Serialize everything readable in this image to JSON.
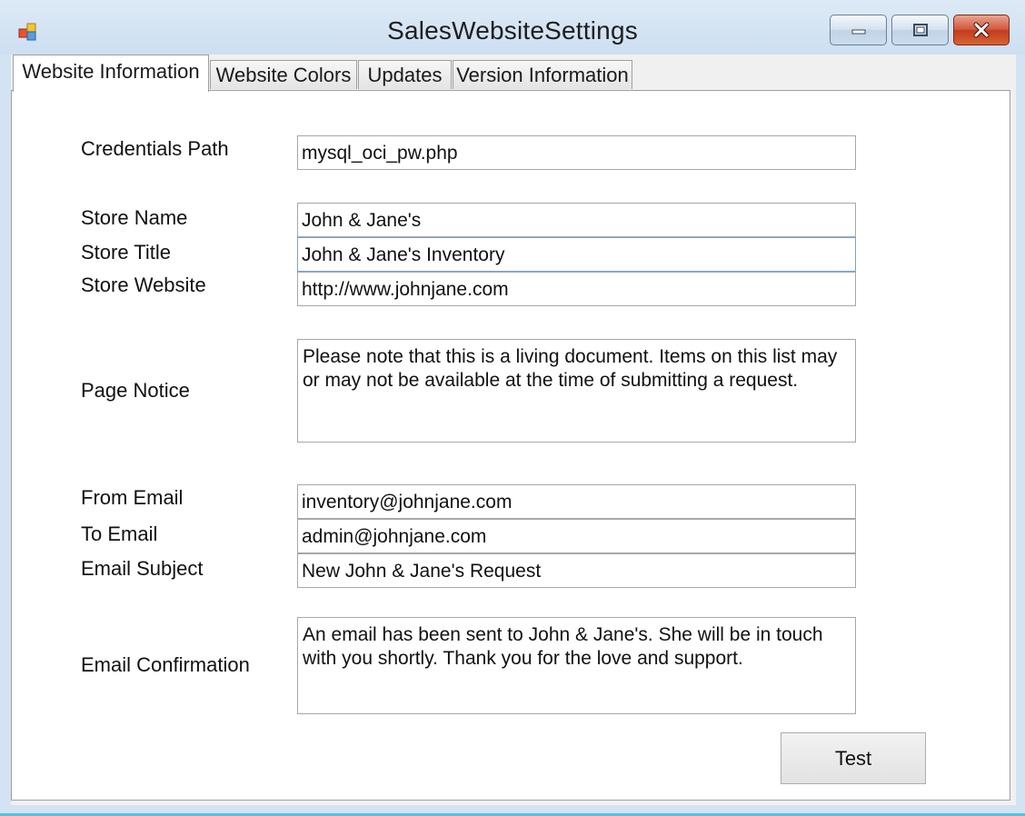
{
  "window": {
    "title": "SalesWebsiteSettings",
    "app_icon": "windows-forms-icon",
    "caption_buttons": [
      "minimize-icon",
      "maximize-icon",
      "close-icon"
    ]
  },
  "tabs": [
    {
      "label": "Website Information",
      "active": true
    },
    {
      "label": "Website Colors",
      "active": false
    },
    {
      "label": "Updates",
      "active": false
    },
    {
      "label": "Version Information",
      "active": false
    }
  ],
  "form": {
    "credentials_path": {
      "label": "Credentials Path",
      "value": "mysql_oci_pw.php"
    },
    "store_name": {
      "label": "Store Name",
      "value": "John & Jane's"
    },
    "store_title": {
      "label": "Store Title",
      "value": "John & Jane's Inventory"
    },
    "store_website": {
      "label": "Store Website",
      "value": "http://www.johnjane.com"
    },
    "page_notice": {
      "label": "Page Notice",
      "value": "Please note that this is a living document. Items on this list may or may not be available at the time of submitting a request."
    },
    "from_email": {
      "label": "From Email",
      "value": "inventory@johnjane.com"
    },
    "to_email": {
      "label": "To Email",
      "value": "admin@johnjane.com"
    },
    "email_subject": {
      "label": "Email Subject",
      "value": "New John & Jane's Request"
    },
    "email_confirmation": {
      "label": "Email Confirmation",
      "value": "An email has been sent to John & Jane's. She will be in touch with you shortly. Thank you for the love and support."
    }
  },
  "buttons": {
    "test_label": "Test"
  },
  "colors": {
    "close_button": "#c13b21",
    "titlebar": "#d3e3f4",
    "focus_border": "#7da2ce"
  }
}
